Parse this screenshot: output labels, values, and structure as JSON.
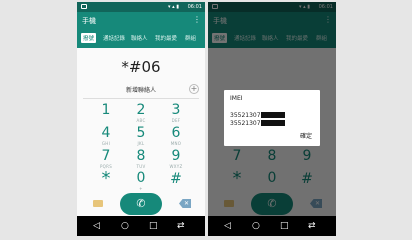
{
  "app": {
    "title": "手機"
  },
  "status": {
    "time": "06:01",
    "icons": "▾ ▴ ▮"
  },
  "tabs": [
    "撥號",
    "通話記錄",
    "聯絡人",
    "我的最愛",
    "群組"
  ],
  "dialer": {
    "number": "*#06",
    "add_contact": "新增聯絡人"
  },
  "keys": [
    {
      "digit": "1",
      "letters": ""
    },
    {
      "digit": "2",
      "letters": "ABC"
    },
    {
      "digit": "3",
      "letters": "DEF"
    },
    {
      "digit": "4",
      "letters": "GHI"
    },
    {
      "digit": "5",
      "letters": "JKL"
    },
    {
      "digit": "6",
      "letters": "MNO"
    },
    {
      "digit": "7",
      "letters": "PQRS"
    },
    {
      "digit": "8",
      "letters": "TUV"
    },
    {
      "digit": "9",
      "letters": "WXYZ"
    },
    {
      "digit": "*",
      "letters": ""
    },
    {
      "digit": "0",
      "letters": "+"
    },
    {
      "digit": "#",
      "letters": ""
    }
  ],
  "icons": {
    "menu": "⋮",
    "call": "✆",
    "plus": "+",
    "backspace": "✕",
    "nav_back": "◁",
    "nav_home": "○",
    "nav_recent": "□",
    "nav_extra": "⇄"
  },
  "dialog": {
    "title": "IMEI",
    "imei_1": "35521307",
    "imei_2": "35521307",
    "ok": "確定"
  },
  "colors": {
    "accent": "#16897a",
    "statusbar": "#11655a",
    "background": "#fafafa"
  }
}
